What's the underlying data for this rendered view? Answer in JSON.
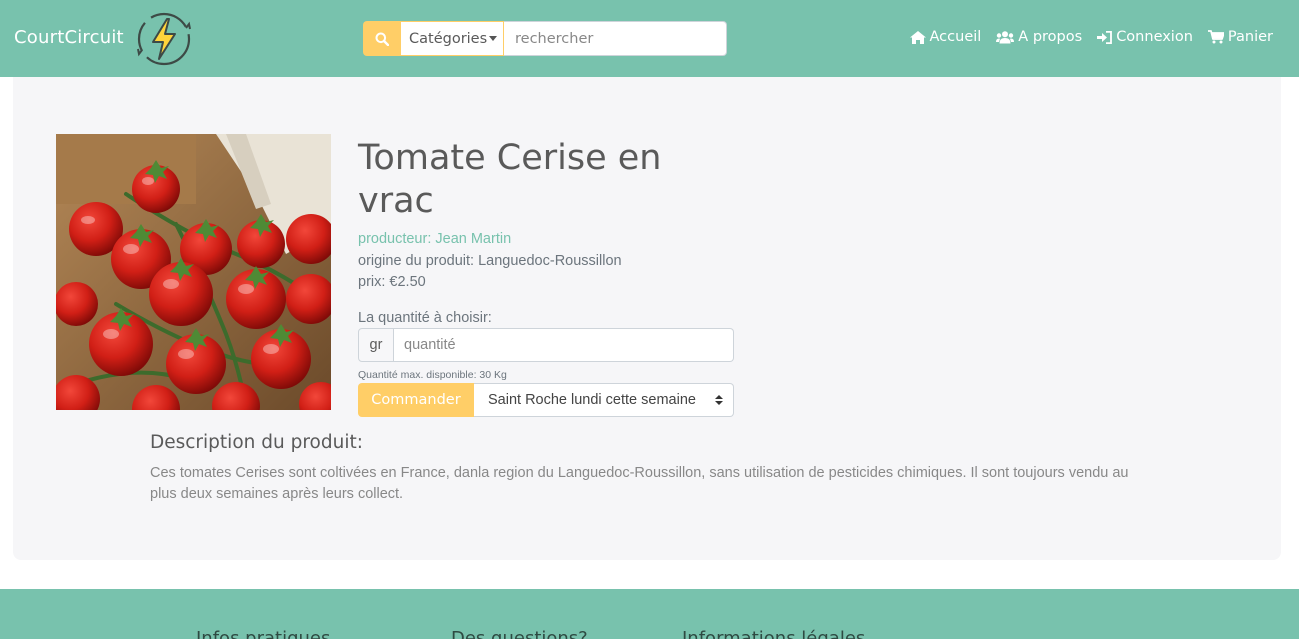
{
  "navbar": {
    "brand": "CourtCircuit",
    "categories_label": "Catégories",
    "search_placeholder": "rechercher",
    "links": [
      {
        "label": "Accueil",
        "icon": "home-icon"
      },
      {
        "label": "A propos",
        "icon": "users-icon"
      },
      {
        "label": "Connexion",
        "icon": "sign-in-icon"
      },
      {
        "label": "Panier",
        "icon": "cart-icon"
      }
    ]
  },
  "product": {
    "title": "Tomate Cerise en vrac",
    "producer": "producteur: Jean Martin",
    "origin": "origine du produit: Languedoc-Roussillon",
    "price": "prix: €2.50",
    "quantity_label": "La quantité à choisir:",
    "quantity_unit": "gr",
    "quantity_placeholder": "quantité",
    "quantity_help": "Quantité max. disponible: 30 Kg",
    "order_button": "Commander",
    "pickup_selected": "Saint Roche lundi cette semaine",
    "description_title": "Description du produit:",
    "description": "Ces tomates Cerises sont coltivées en France, danla region du Languedoc-Roussillon, sans utilisation de pesticides chimiques. Il sont toujours vendu au plus deux semaines après leurs collect."
  },
  "footer": {
    "headings": [
      "Infos pratiques",
      "Des questions?",
      "Informations légales"
    ]
  },
  "colors": {
    "primary": "#78c2ad",
    "warning": "#ffce67",
    "card_bg": "#f6f6f8"
  }
}
